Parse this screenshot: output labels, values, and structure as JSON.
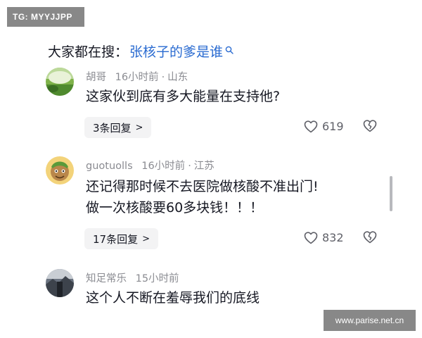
{
  "watermarks": {
    "top_left": "TG: MYYJJPP",
    "bottom_right": "www.parise.net.cn"
  },
  "search": {
    "prefix": "大家都在搜：",
    "query": "张核子的爹是谁",
    "icon": "search-icon",
    "query_color": "#2a6bd1"
  },
  "comments": [
    {
      "user": "胡哥",
      "time": "16小时前",
      "location": "山东",
      "text_lines": [
        "这家伙到底有多大能量在支持他?"
      ],
      "reply_label": "3条回复",
      "likes": "619"
    },
    {
      "user": "guotuolls",
      "time": "16小时前",
      "location": "江苏",
      "text_lines": [
        "还记得那时候不去医院做核酸不准出门!",
        "做一次核酸要60多块钱！！！"
      ],
      "reply_label": "17条回复",
      "likes": "832"
    },
    {
      "user": "知足常乐",
      "time": "15小时前",
      "location": "",
      "text_lines": [
        "这个人不断在羞辱我们的底线"
      ]
    }
  ],
  "meta_separator": "·",
  "reply_chevron": ">"
}
